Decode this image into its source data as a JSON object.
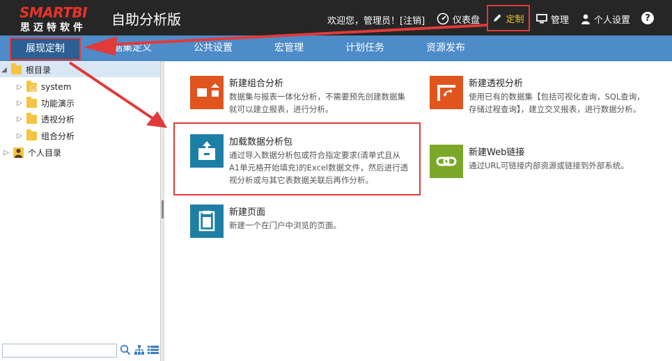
{
  "header": {
    "logo_text": "SMARTBI",
    "logo_sub": "思迈特软件",
    "app_title": "自助分析版",
    "welcome": "欢迎您，管理员！[",
    "logout": "注销",
    "welcome_end": "]",
    "dashboard": "仪表盘",
    "customize": "定制",
    "manage": "管理",
    "personal": "个人设置",
    "help": "?"
  },
  "nav": {
    "tabs": [
      "展现定制",
      "数据集定义",
      "公共设置",
      "宏管理",
      "计划任务",
      "资源发布"
    ]
  },
  "tree": {
    "items": [
      {
        "label": "根目录"
      },
      {
        "label": "system"
      },
      {
        "label": "功能演示"
      },
      {
        "label": "透视分析"
      },
      {
        "label": "组合分析"
      },
      {
        "label": "个人目录"
      }
    ]
  },
  "cards": [
    {
      "title": "新建组合分析",
      "desc": "数据集与报表一体化分析，不需要预先创建数据集就可以建立报表，进行分析。",
      "color": "#e0541d"
    },
    {
      "title": "新建透视分析",
      "desc": "使用已有的数据集【包括可视化查询，SQL查询，存储过程查询】，建立交叉报表，进行数据分析。",
      "color": "#e0541d"
    },
    {
      "title": "加载数据分析包",
      "desc": "通过导入数据分析包或符合指定要求(清单式且从A1单元格开始填充)的Excel数据文件，然后进行透视分析或与其它表数据关联后再作分析。",
      "color": "#1e7fa6"
    },
    {
      "title": "新建Web链接",
      "desc": "通过URL可链接内部资源或链接到外部系统。",
      "color": "#7ba829"
    },
    {
      "title": "新建页面",
      "desc": "新建一个在门户中浏览的页面。",
      "color": "#1e7fa6"
    }
  ],
  "colors": {
    "header_bg": "#262626",
    "nav_bg": "#4e8bc9",
    "highlight": "#e13a3a"
  }
}
